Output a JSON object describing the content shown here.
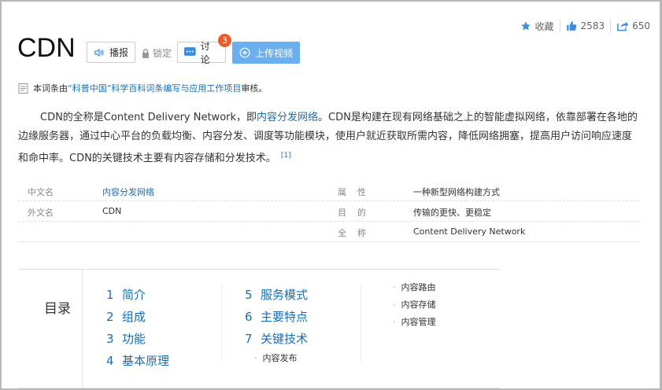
{
  "header": {
    "title": "CDN",
    "broadcast_label": "播报",
    "lock_label": "锁定",
    "discuss_label": "讨论",
    "discuss_count": "3",
    "upload_label": "上传视频"
  },
  "stats": {
    "favorite_label": "收藏",
    "likes": "2583",
    "shares": "650"
  },
  "review": {
    "prefix": "本词条由",
    "org": "“科普中国”科学百科词条编写与应用工作项目",
    "suffix": " 审核。"
  },
  "summary": {
    "part1": "CDN的全称是Content Delivery Network，即",
    "link": "内容分发网络",
    "part2": "。CDN是构建在现有网络基础之上的智能虚拟网络，依靠部署在各地的边缘服务器，通过中心平台的负载均衡、内容分发、调度等功能模块，使用户就近获取所需内容，降低网络拥塞，提高用户访问响应速度和命中率。CDN的关键技术主要有内容存储和分发技术。",
    "ref": "[1]"
  },
  "info": {
    "rows": [
      {
        "k1": "中文名",
        "v1": "内容分发网络",
        "k2": "属性",
        "v2": "一种新型网络构建方式"
      },
      {
        "k1": "外文名",
        "v1": "CDN",
        "k2": "目的",
        "v2": "传输的更快、更稳定"
      },
      {
        "k1": "",
        "v1": "",
        "k2": "全称",
        "v2": "Content Delivery Network"
      }
    ]
  },
  "toc": {
    "title": "目录",
    "col1": [
      {
        "num": "1",
        "label": "简介"
      },
      {
        "num": "2",
        "label": "组成"
      },
      {
        "num": "3",
        "label": "功能"
      },
      {
        "num": "4",
        "label": "基本原理"
      }
    ],
    "col2": [
      {
        "num": "5",
        "label": "服务模式"
      },
      {
        "num": "6",
        "label": "主要特点"
      },
      {
        "num": "7",
        "label": "关键技术"
      }
    ],
    "col2_sub": [
      "内容发布"
    ],
    "col3_sub": [
      "内容路由",
      "内容存储",
      "内容管理"
    ]
  },
  "colors": {
    "link": "#136ec2",
    "upload": "#6ab0f0",
    "badge": "#f05a28"
  }
}
